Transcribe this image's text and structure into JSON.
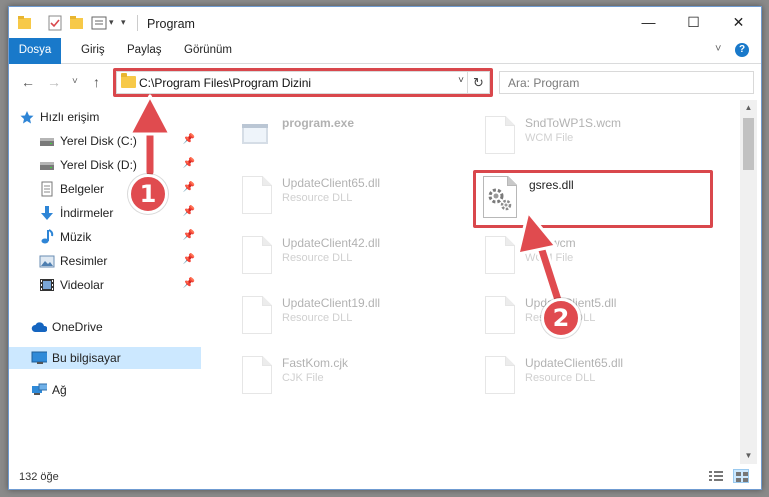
{
  "window": {
    "title": "Program",
    "minimize_glyph": "—",
    "maximize_glyph": "☐",
    "close_glyph": "✕"
  },
  "ribbon": {
    "tabs": [
      "Dosya",
      "Giriş",
      "Paylaş",
      "Görünüm"
    ],
    "file_tab_color": "#1979ca",
    "expand_glyph": "˅",
    "help_glyph": "?"
  },
  "address": {
    "back_glyph": "←",
    "forward_glyph": "→",
    "recent_glyph": "˅",
    "up_glyph": "↑",
    "path": "C:\\Program Files\\Program Dizini",
    "dropdown_glyph": "˅",
    "refresh_glyph": "↻"
  },
  "search": {
    "placeholder": "Ara: Program",
    "icon": "search-icon"
  },
  "nav": {
    "items": [
      {
        "label": "Hızlı erişim",
        "icon": "star-icon",
        "pinned": false
      },
      {
        "label": "Yerel Disk (C:)",
        "icon": "drive-icon",
        "pinned": true
      },
      {
        "label": "Yerel Disk (D:)",
        "icon": "drive-icon",
        "pinned": true
      },
      {
        "label": "Belgeler",
        "icon": "documents-icon",
        "pinned": true
      },
      {
        "label": "İndirmeler",
        "icon": "download-icon",
        "pinned": true
      },
      {
        "label": "Müzik",
        "icon": "music-icon",
        "pinned": true
      },
      {
        "label": "Resimler",
        "icon": "pictures-icon",
        "pinned": true
      },
      {
        "label": "Videolar",
        "icon": "videos-icon",
        "pinned": true
      },
      {
        "label": "OneDrive",
        "icon": "cloud-icon",
        "pinned": false
      },
      {
        "label": "Bu bilgisayar",
        "icon": "computer-icon",
        "pinned": false,
        "selected": true
      },
      {
        "label": "Ağ",
        "icon": "network-icon",
        "pinned": false
      }
    ],
    "pin_glyph": "📌"
  },
  "files": [
    {
      "name": "program.exe",
      "type": "",
      "icon": "exe-icon"
    },
    {
      "name": "SndToWP1S.wcm",
      "type": "WCM File",
      "icon": "file-icon"
    },
    {
      "name": "UpdateClient65.dll",
      "type": "Resource DLL",
      "icon": "dll-icon"
    },
    {
      "name": "gsres.dll",
      "type": "",
      "icon": "dll-icon",
      "highlighted": true
    },
    {
      "name": "UpdateClient42.dll",
      "type": "Resource DLL",
      "icon": "dll-icon"
    },
    {
      "name": "...wcm",
      "type": "WCM File",
      "icon": "file-icon"
    },
    {
      "name": "UpdateClient19.dll",
      "type": "Resource DLL",
      "icon": "dll-icon"
    },
    {
      "name": "UpdateClient5.dll",
      "type": "Resource DLL",
      "icon": "dll-icon"
    },
    {
      "name": "FastKom.cjk",
      "type": "CJK File",
      "icon": "file-icon"
    },
    {
      "name": "UpdateClient65.dll",
      "type": "Resource DLL",
      "icon": "dll-icon"
    }
  ],
  "status": {
    "count": "132 öğe"
  },
  "annotations": {
    "badge1": "1",
    "badge2": "2",
    "color": "#e04b4f"
  }
}
